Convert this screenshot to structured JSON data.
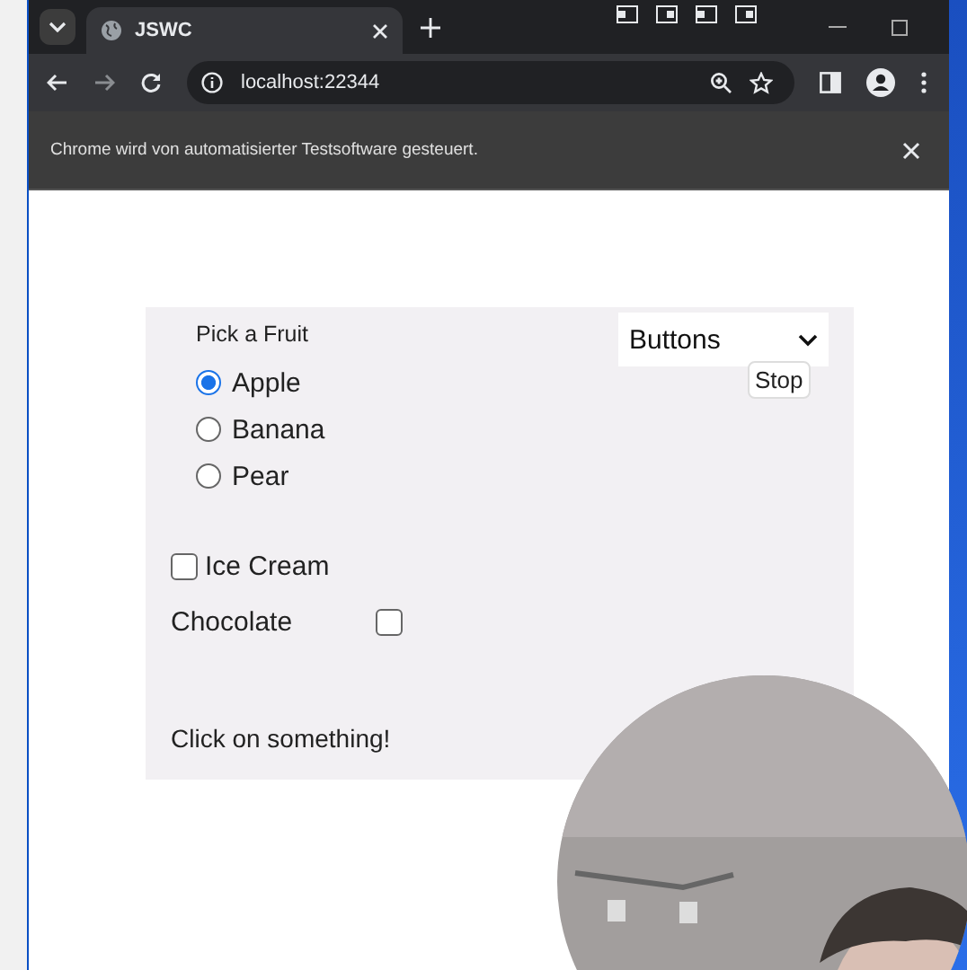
{
  "browser": {
    "tab": {
      "title": "JSWC",
      "selected": true
    },
    "address": "localhost:22344",
    "infobar": "Chrome wird von automatisierter Testsoftware gesteuert."
  },
  "page": {
    "fruit_group": {
      "legend": "Pick a Fruit",
      "options": [
        {
          "label": "Apple",
          "selected": true
        },
        {
          "label": "Banana",
          "selected": false
        },
        {
          "label": "Pear",
          "selected": false
        }
      ]
    },
    "dropdown": {
      "value": "Buttons"
    },
    "tooltip": "Stop",
    "checkboxes": [
      {
        "kind": "box-first",
        "label": "Ice Cream",
        "checked": false
      },
      {
        "kind": "label-first",
        "label": "Chocolate",
        "checked": false
      }
    ],
    "status": "Click on something!"
  }
}
